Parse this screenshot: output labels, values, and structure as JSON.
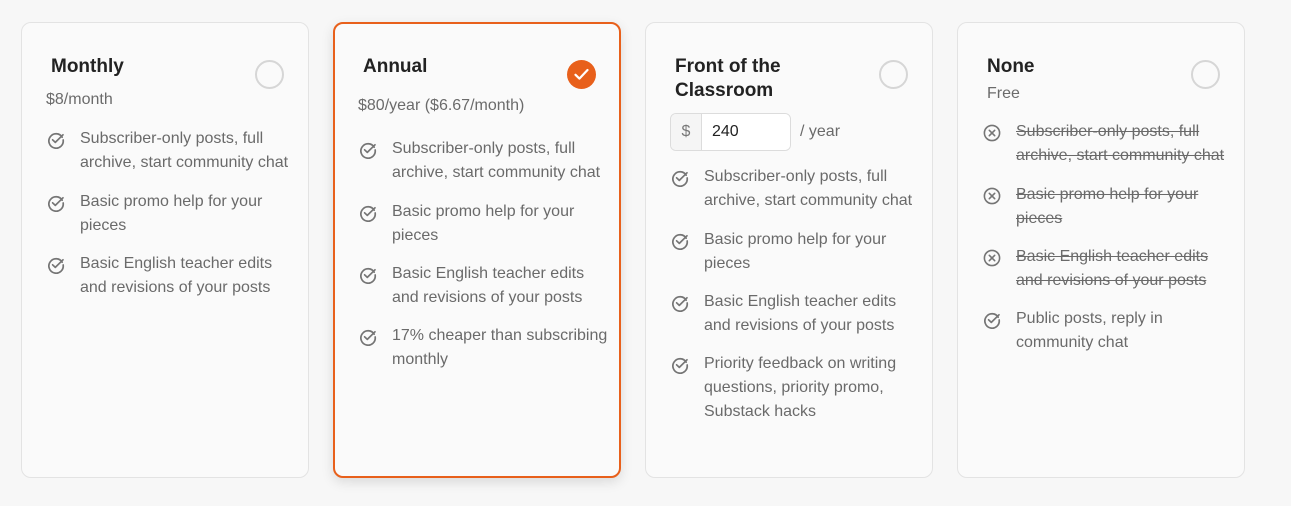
{
  "colors": {
    "accent": "#e8601b",
    "card_border": "#e3e3e3",
    "text_muted": "#6a6a6a",
    "title": "#222222"
  },
  "plans": [
    {
      "title": "Monthly",
      "price": "$8/month",
      "selected": false,
      "features": [
        {
          "text": "Subscriber-only posts, full archive, start community chat",
          "included": true,
          "icon": "check-circle-icon"
        },
        {
          "text": "Basic promo help for your pieces",
          "included": true,
          "icon": "check-circle-icon"
        },
        {
          "text": "Basic English teacher edits and revisions of your posts",
          "included": true,
          "icon": "check-circle-icon"
        }
      ]
    },
    {
      "title": "Annual",
      "price": "$80/year ($6.67/month)",
      "selected": true,
      "features": [
        {
          "text": "Subscriber-only posts, full archive, start community chat",
          "included": true,
          "icon": "check-circle-icon"
        },
        {
          "text": "Basic promo help for your pieces",
          "included": true,
          "icon": "check-circle-icon"
        },
        {
          "text": "Basic English teacher edits and revisions of your posts",
          "included": true,
          "icon": "check-circle-icon"
        },
        {
          "text": "17% cheaper than subscribing monthly",
          "included": true,
          "icon": "check-circle-icon"
        }
      ]
    },
    {
      "title": "Front of the Classroom",
      "currency_symbol": "$",
      "amount_value": "240",
      "per_label": "/ year",
      "selected": false,
      "features": [
        {
          "text": "Subscriber-only posts, full archive, start community chat",
          "included": true,
          "icon": "check-circle-icon"
        },
        {
          "text": "Basic promo help for your pieces",
          "included": true,
          "icon": "check-circle-icon"
        },
        {
          "text": "Basic English teacher edits and revisions of your posts",
          "included": true,
          "icon": "check-circle-icon"
        },
        {
          "text": "Priority feedback on writing questions, priority promo, Substack hacks",
          "included": true,
          "icon": "check-circle-icon"
        }
      ]
    },
    {
      "title": "None",
      "price": "Free",
      "selected": false,
      "features": [
        {
          "text": "Subscriber-only posts, full archive, start community chat",
          "included": false,
          "icon": "x-circle-icon"
        },
        {
          "text": "Basic promo help for your pieces",
          "included": false,
          "icon": "x-circle-icon"
        },
        {
          "text": "Basic English teacher edits and revisions of your posts",
          "included": false,
          "icon": "x-circle-icon"
        },
        {
          "text": "Public posts, reply in community chat",
          "included": true,
          "icon": "check-circle-icon"
        }
      ]
    }
  ]
}
